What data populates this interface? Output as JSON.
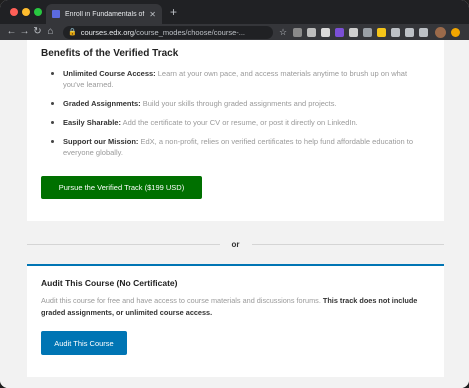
{
  "browser": {
    "tab_title": "Enroll in Fundamentals of TinyML",
    "tab_close": "✕",
    "new_tab": "+",
    "url_host": "courses.edx.org",
    "url_path": "/course_modes/choose/course-...",
    "nav": {
      "back": "←",
      "forward": "→",
      "reload": "↻",
      "home": "⌂"
    },
    "lock": "🔒",
    "star": "☆",
    "extension_colors": [
      "#8a8a8a",
      "#bdbdbd",
      "#d9d9d9",
      "#7b4fd6",
      "#cfcfcf",
      "#9aa0a6",
      "#f5c518",
      "#bdc1c6",
      "#bdc1c6",
      "#bdc1c6"
    ]
  },
  "verified_track": {
    "heading": "Benefits of the Verified Track",
    "benefits": [
      {
        "title": "Unlimited Course Access:",
        "text": " Learn at your own pace, and access materials anytime to brush up on what you've learned."
      },
      {
        "title": "Graded Assignments:",
        "text": " Build your skills through graded assignments and projects."
      },
      {
        "title": "Easily Sharable:",
        "text": " Add the certificate to your CV or resume, or post it directly on LinkedIn."
      },
      {
        "title": "Support our Mission:",
        "text": " EdX, a non-profit, relies on verified certificates to help fund affordable education to everyone globally."
      }
    ],
    "button_label": "Pursue the Verified Track ($199 USD)"
  },
  "divider_label": "or",
  "audit": {
    "heading": "Audit This Course (No Certificate)",
    "description": "Audit this course for free and have access to course materials and discussions forums. ",
    "description_strong": "This track does not include graded assignments, or unlimited course access.",
    "button_label": "Audit This Course"
  },
  "colors": {
    "verified_button": "#007000",
    "audit_button": "#0075b4",
    "audit_border": "#0075b4"
  }
}
